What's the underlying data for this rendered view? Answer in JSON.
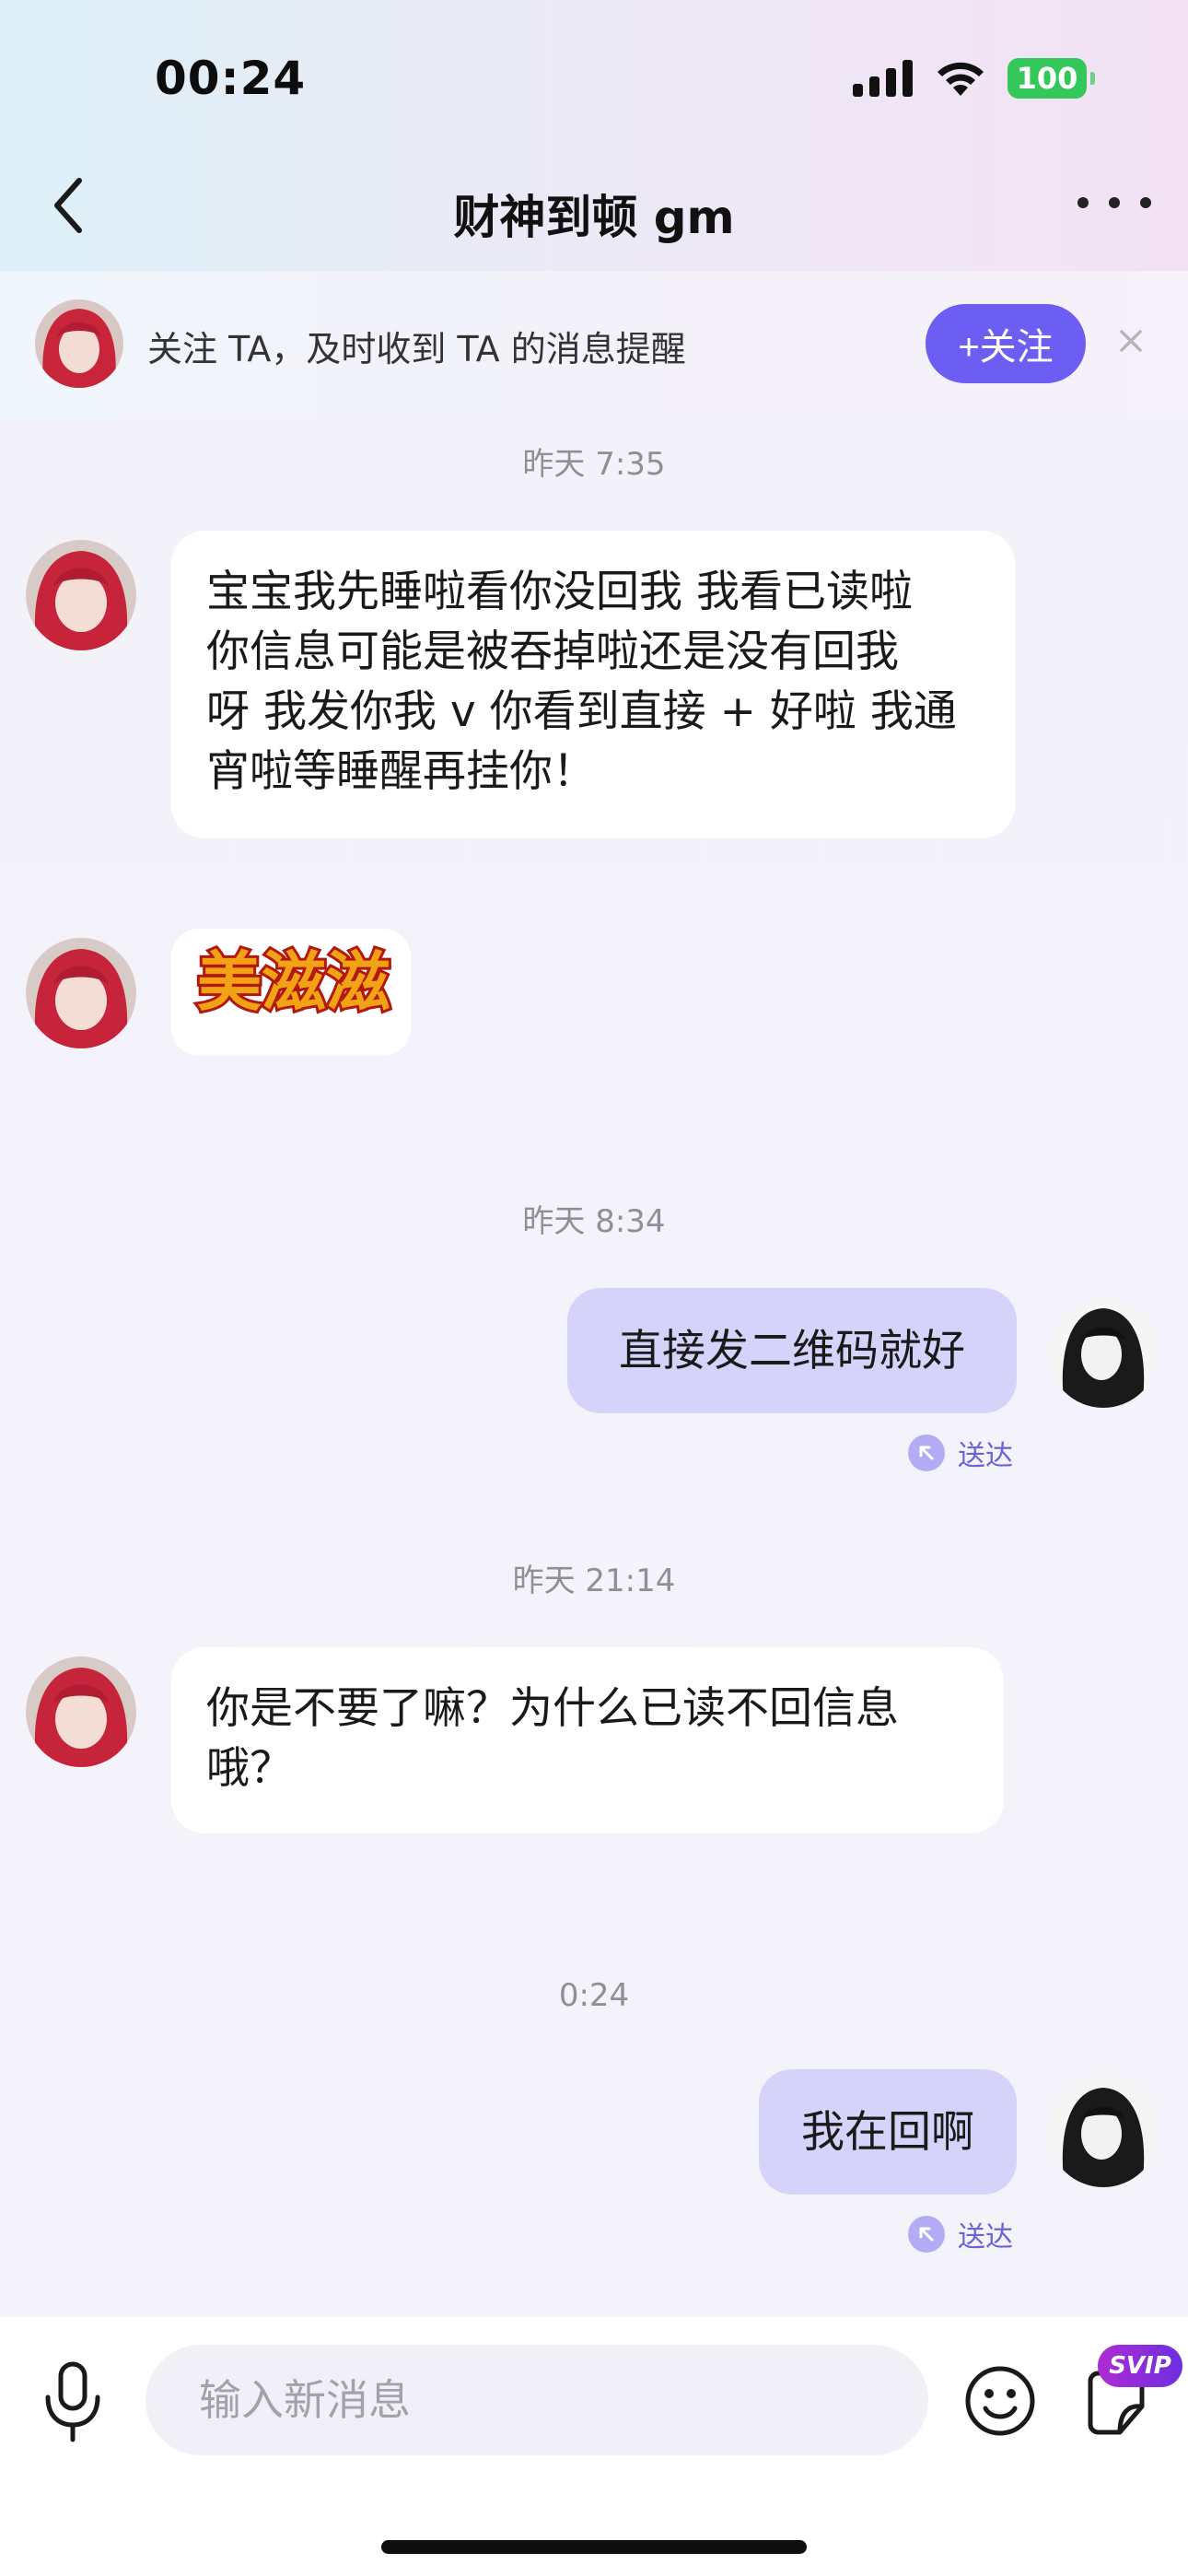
{
  "status_bar": {
    "time": "00:24",
    "battery": "100"
  },
  "header": {
    "title": "财神到顿 gm"
  },
  "follow_banner": {
    "text": "关注 TA，及时收到 TA 的消息提醒",
    "button_label": "+关注"
  },
  "messages": [
    {
      "type": "timestamp",
      "text": "昨天 7:35"
    },
    {
      "type": "incoming",
      "lines": [
        "宝宝我先睡啦看你没回我 我看已读啦",
        "你信息可能是被吞掉啦还是没有回我",
        "呀 我发你我 v 你看到直接 + 好啦 我通",
        "宵啦等睡醒再挂你！"
      ]
    },
    {
      "type": "incoming-sticker",
      "text": "美滋滋"
    },
    {
      "type": "timestamp",
      "text": "昨天 8:34"
    },
    {
      "type": "outgoing",
      "text": "直接发二维码就好",
      "status": "送达"
    },
    {
      "type": "timestamp",
      "text": "昨天 21:14"
    },
    {
      "type": "incoming",
      "lines": [
        "你是不要了嘛？为什么已读不回信息",
        "哦？"
      ]
    },
    {
      "type": "timestamp",
      "text": "0:24"
    },
    {
      "type": "outgoing",
      "text": "我在回啊",
      "status": "送达"
    }
  ],
  "input_bar": {
    "placeholder": "输入新消息",
    "badge": "SVIP"
  },
  "colors": {
    "accent": "#6d5ef3",
    "outgoing_bubble": "#d6d3fb",
    "incoming_bubble": "#ffffff"
  }
}
